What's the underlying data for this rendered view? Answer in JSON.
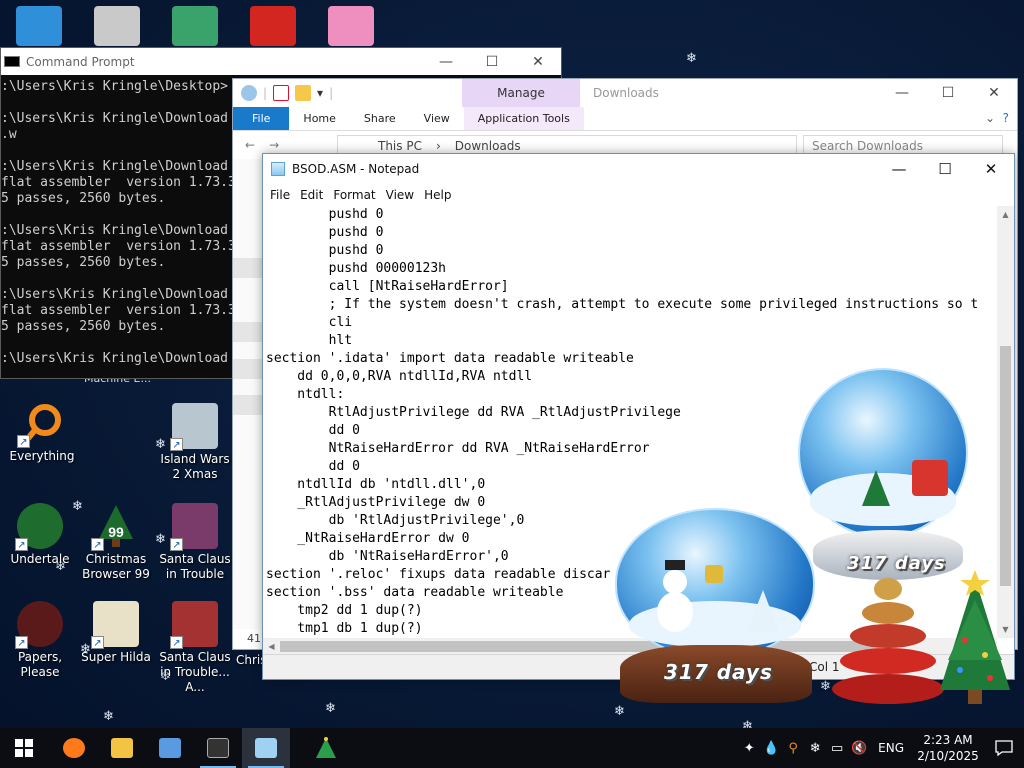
{
  "desktop": {
    "top_icon_row": [
      {
        "name": "ie-icon",
        "color": "#2f8fd8"
      },
      {
        "name": "photo-app-icon",
        "color": "#c9c9c9"
      },
      {
        "name": "character-game-icon",
        "color": "#3aa36b"
      },
      {
        "name": "mcdonalds-icon",
        "color": "#d42620"
      },
      {
        "name": "pig-game-icon",
        "color": "#ee8fc0"
      }
    ],
    "hidden_icon_label": "Machine E...",
    "icons": [
      {
        "label": "Everything",
        "color": "#f08a1a"
      },
      {
        "label": "Island Wars 2 Xmas",
        "color": "#b7c6cf"
      },
      {
        "label": "Undertale",
        "color": "#2b8d3c"
      },
      {
        "label": "Christmas Browser 99",
        "color": "#1d6a2d"
      },
      {
        "label": "Santa Claus in Trouble",
        "color": "#7a3a6a"
      },
      {
        "label": "Papers, Please",
        "color": "#5b1a1a"
      },
      {
        "label": "Super Hilda",
        "color": "#e9e0c8"
      },
      {
        "label": "Santa Claus in Trouble... A...",
        "color": "#a53232"
      },
      {
        "label": "Chris",
        "color": "#333333"
      }
    ]
  },
  "cmd": {
    "title": "Command Prompt",
    "lines": [
      ":\\Users\\Kris Kringle\\Desktop>",
      "",
      ":\\Users\\Kris Kringle\\Download",
      ".w",
      "",
      ":\\Users\\Kris Kringle\\Download",
      "flat assembler  version 1.73.3",
      "5 passes, 2560 bytes.",
      "",
      ":\\Users\\Kris Kringle\\Download",
      "flat assembler  version 1.73.3",
      "5 passes, 2560 bytes.",
      "",
      ":\\Users\\Kris Kringle\\Download",
      "flat assembler  version 1.73.3",
      "5 passes, 2560 bytes.",
      "",
      ":\\Users\\Kris Kringle\\Download"
    ]
  },
  "explorer": {
    "title": "Downloads",
    "manage_tab": "Manage",
    "ribbon_tabs": [
      "File",
      "Home",
      "Share",
      "View",
      "Application Tools"
    ],
    "breadcrumb": [
      "This PC",
      "Downloads"
    ],
    "search_placeholder": "Search Downloads",
    "item_count": "41"
  },
  "notepad": {
    "title": "BSOD.ASM - Notepad",
    "menu": [
      "File",
      "Edit",
      "Format",
      "View",
      "Help"
    ],
    "lines": [
      "        pushd 0",
      "        pushd 0",
      "        pushd 0",
      "        pushd 00000123h",
      "        call [NtRaiseHardError]",
      "        ; If the system doesn't crash, attempt to execute some privileged instructions so t",
      "        cli",
      "        hlt",
      "section '.idata' import data readable writeable",
      "    dd 0,0,0,RVA ntdllId,RVA ntdll",
      "    ntdll:",
      "        RtlAdjustPrivilege dd RVA _RtlAdjustPrivilege",
      "        dd 0",
      "        NtRaiseHardError dd RVA _NtRaiseHardError",
      "        dd 0",
      "    ntdllId db 'ntdll.dll',0",
      "    _RtlAdjustPrivilege dw 0",
      "        db 'RtlAdjustPrivilege',0",
      "    _NtRaiseHardError dw 0",
      "        db 'NtRaiseHardError',0",
      "section '.reloc' fixups data readable discar",
      "section '.bss' data readable writeable",
      "    tmp2 dd 1 dup(?)",
      "    tmp1 db 1 dup(?)"
    ],
    "status_position": "Col 1"
  },
  "globes": {
    "front_days": "317 days",
    "back_days": "317 days"
  },
  "taskbar": {
    "apps": [
      {
        "name": "firefox-icon",
        "color": "#ff7a1a"
      },
      {
        "name": "file-explorer-icon",
        "color": "#f3c343"
      },
      {
        "name": "game-app-icon",
        "color": "#5a9ae0"
      },
      {
        "name": "command-prompt-icon",
        "color": "#333333"
      },
      {
        "name": "notepad-icon",
        "color": "#9fd2f2"
      }
    ],
    "language": "ENG",
    "time": "2:23 AM",
    "date": "2/10/2025"
  },
  "colors": {
    "accent_blue": "#1979ca",
    "manage_purple": "#e8d6f7",
    "desktop_bg": "#0b1e3f"
  }
}
